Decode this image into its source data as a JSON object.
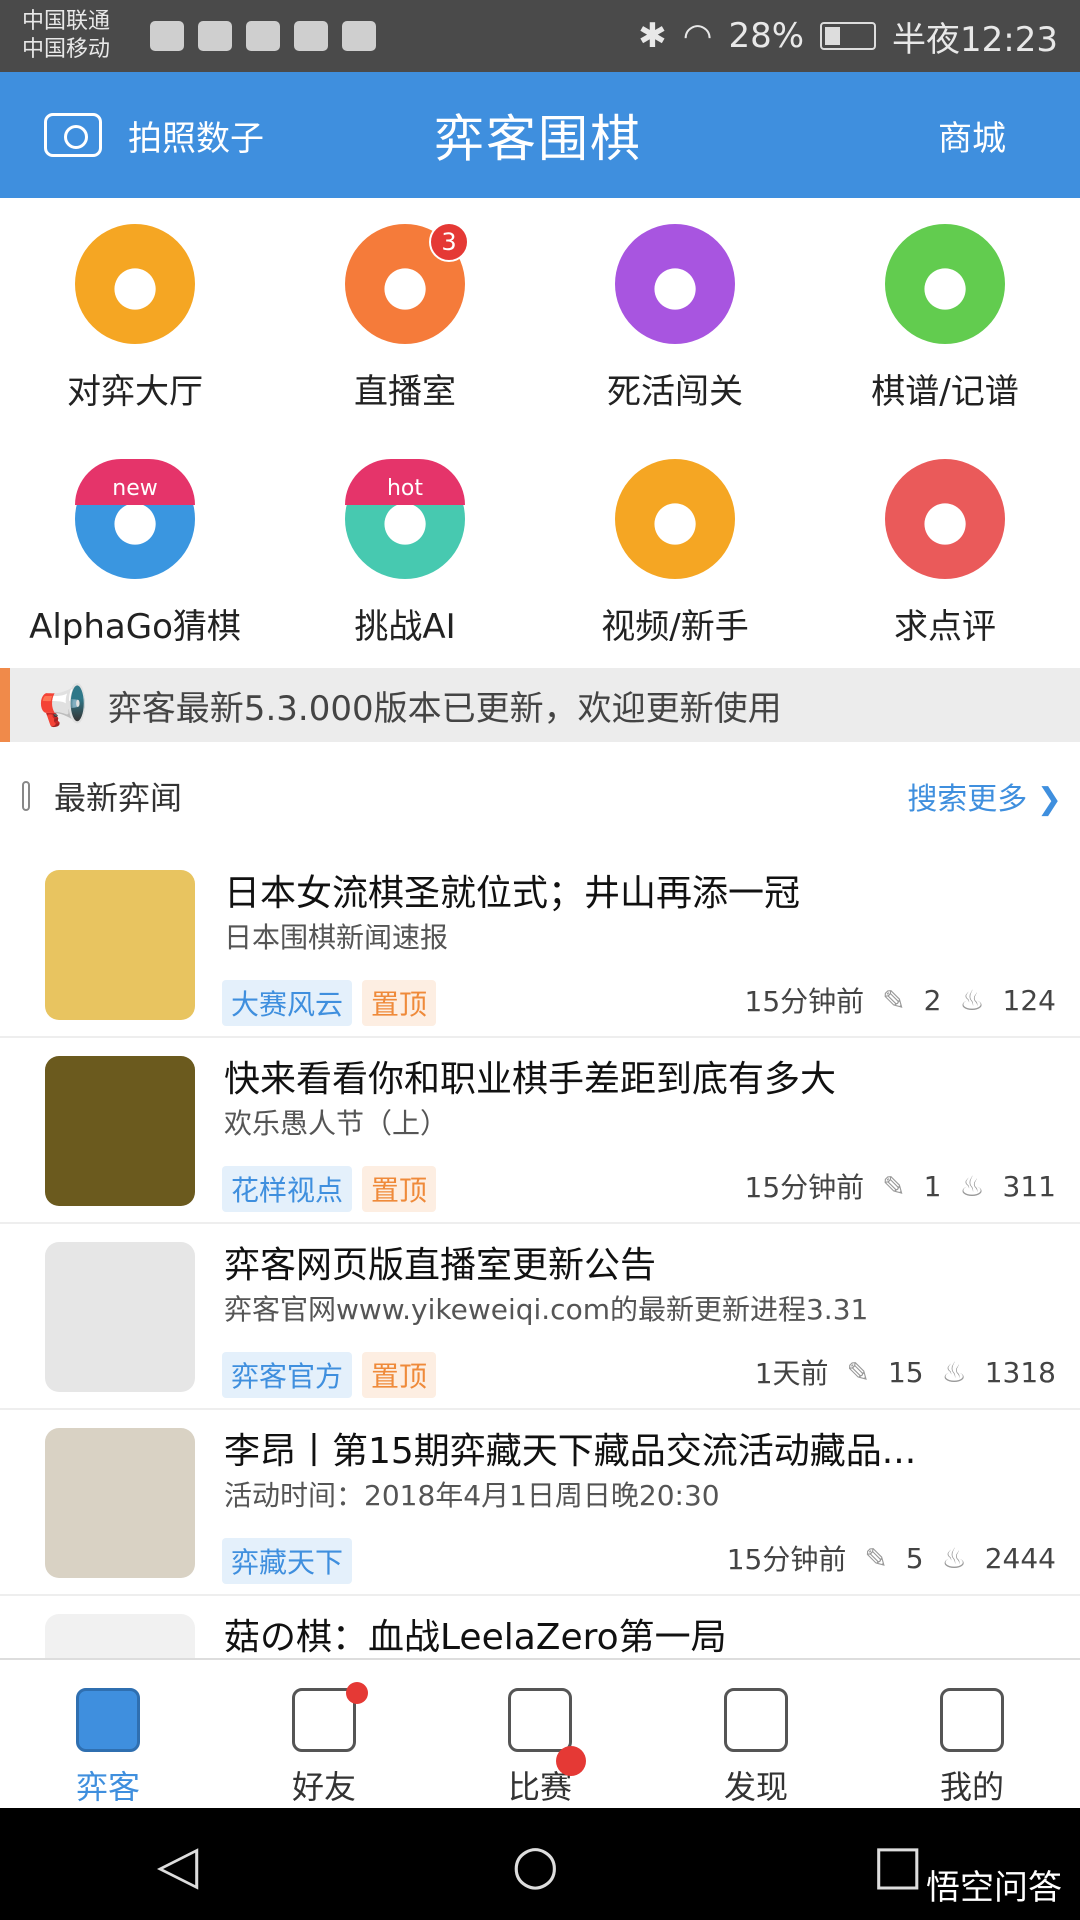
{
  "status": {
    "carrier1": "中国联通",
    "carrier2": "中国移动",
    "battery": "28%",
    "time": "半夜12:23"
  },
  "topbar": {
    "left_label": "拍照数子",
    "title": "弈客围棋",
    "right_label": "商城"
  },
  "features": [
    {
      "label": "对弈大厅",
      "color": "#f5a623",
      "icon": "hand-icon"
    },
    {
      "label": "直播室",
      "color": "#f57b3a",
      "icon": "camera-icon",
      "badge": "3"
    },
    {
      "label": "死活闯关",
      "color": "#a855e0",
      "icon": "ghost-icon"
    },
    {
      "label": "棋谱/记谱",
      "color": "#62cc4f",
      "icon": "board-icon"
    },
    {
      "label": "AlphaGo猜棋",
      "color": "#3a96e0",
      "icon": "alphago-icon",
      "cap": "new"
    },
    {
      "label": "挑战AI",
      "color": "#47c9b0",
      "icon": "robot-icon",
      "cap": "hot"
    },
    {
      "label": "视频/新手",
      "color": "#f5a623",
      "icon": "video-icon"
    },
    {
      "label": "求点评",
      "color": "#ea5a5a",
      "icon": "comment-icon"
    }
  ],
  "notice": {
    "text": "弈客最新5.3.000版本已更新，欢迎更新使用"
  },
  "section": {
    "title": "最新弈闻",
    "more": "搜索更多"
  },
  "news": [
    {
      "title": "日本女流棋圣就位式；井山再添一冠",
      "sub": "日本围棋新闻速报",
      "tags": [
        "大赛风云",
        "置顶"
      ],
      "time": "15分钟前",
      "comments": "2",
      "hot": "124",
      "thumb": "#e8c460"
    },
    {
      "title": "快来看看你和职业棋手差距到底有多大",
      "sub": "欢乐愚人节（上）",
      "tags": [
        "花样视点",
        "置顶"
      ],
      "time": "15分钟前",
      "comments": "1",
      "hot": "311",
      "thumb": "#6b5a1e"
    },
    {
      "title": "弈客网页版直播室更新公告",
      "sub": "弈客官网www.yikeweiqi.com的最新更新进程3.31",
      "tags": [
        "弈客官方",
        "置顶"
      ],
      "time": "1天前",
      "comments": "15",
      "hot": "1318",
      "thumb": "#e6e6e6"
    },
    {
      "title": "李昂丨第15期弈藏天下藏品交流活动藏品...",
      "sub": "活动时间：2018年4月1日周日晚20:30",
      "tags": [
        "弈藏天下"
      ],
      "time": "15分钟前",
      "comments": "5",
      "hot": "2444",
      "thumb": "#d9d2c4"
    },
    {
      "title": "菇の棋：血战LeelaZero第一局",
      "sub": "",
      "tags": [],
      "time": "",
      "comments": "",
      "hot": "",
      "thumb": "#f1f1f1"
    }
  ],
  "nav": [
    {
      "label": "弈客",
      "icon": "bookmark-icon",
      "active": true
    },
    {
      "label": "好友",
      "icon": "person-icon"
    },
    {
      "label": "比赛",
      "icon": "bracket-icon"
    },
    {
      "label": "发现",
      "icon": "compass-icon"
    },
    {
      "label": "我的",
      "icon": "profile-card-icon"
    }
  ],
  "watermark": "悟空问答"
}
